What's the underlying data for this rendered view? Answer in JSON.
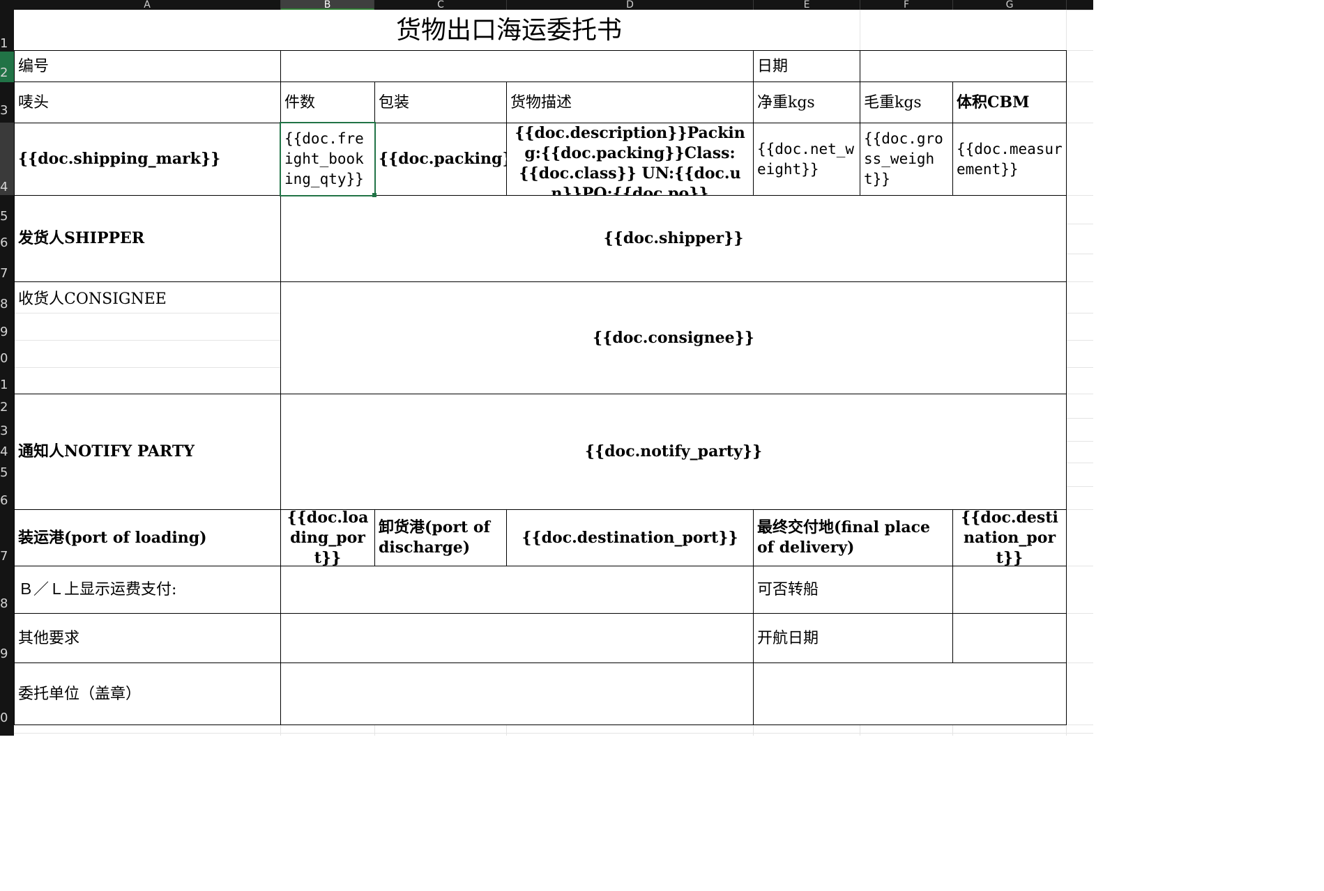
{
  "columns": [
    "A",
    "B",
    "C",
    "D",
    "E",
    "F",
    "G"
  ],
  "active_column": "B",
  "rows": [
    "1",
    "2",
    "3",
    "4",
    "5",
    "6",
    "7",
    "8",
    "9",
    "0",
    "1",
    "2",
    "3",
    "4",
    "5",
    "6",
    "7",
    "8",
    "9",
    "0"
  ],
  "form": {
    "title": "货物出口海运委托书",
    "number_label": "编号",
    "date_label": "日期",
    "mark_label": "唛头",
    "qty_label": "件数",
    "packing_label": "包装",
    "desc_label": "货物描述",
    "net_label": "净重kgs",
    "gross_label": "毛重kgs",
    "volume_label": "体积CBM",
    "mark_value": "{{doc.shipping_mark}}",
    "qty_value": "{{doc.freight_booking_qty}}",
    "packing_value": "{{doc.packing}}",
    "desc_value": "{{doc.description}}Packing:{{doc.packing}}Class:{{doc.class}} UN:{{doc.un}}PO:{{doc.po}}",
    "net_value": "{{doc.net_weight}}",
    "gross_value": "{{doc.gross_weight}}",
    "volume_value": "{{doc.measurement}}",
    "shipper_label": "发货人SHIPPER",
    "shipper_value": "{{doc.shipper}}",
    "consignee_label": "收货人CONSIGNEE",
    "consignee_value": "{{doc.consignee}}",
    "notify_label": "通知人NOTIFY PARTY",
    "notify_value": "{{doc.notify_party}}",
    "pol_label": "装运港(port of loading)",
    "pol_value": "{{doc.loading_port}}",
    "pod_label": "卸货港(port of discharge)",
    "pod_value": "{{doc.destination_port}}",
    "final_label": "最终交付地(final place of delivery)",
    "final_value": "{{doc.destination_port}}",
    "freight_label": "Ｂ／Ｌ上显示运费支付:",
    "transship_label": "可否转船",
    "other_label": "其他要求",
    "sailing_label": "开航日期",
    "agent_label": "委托单位（盖章）"
  }
}
